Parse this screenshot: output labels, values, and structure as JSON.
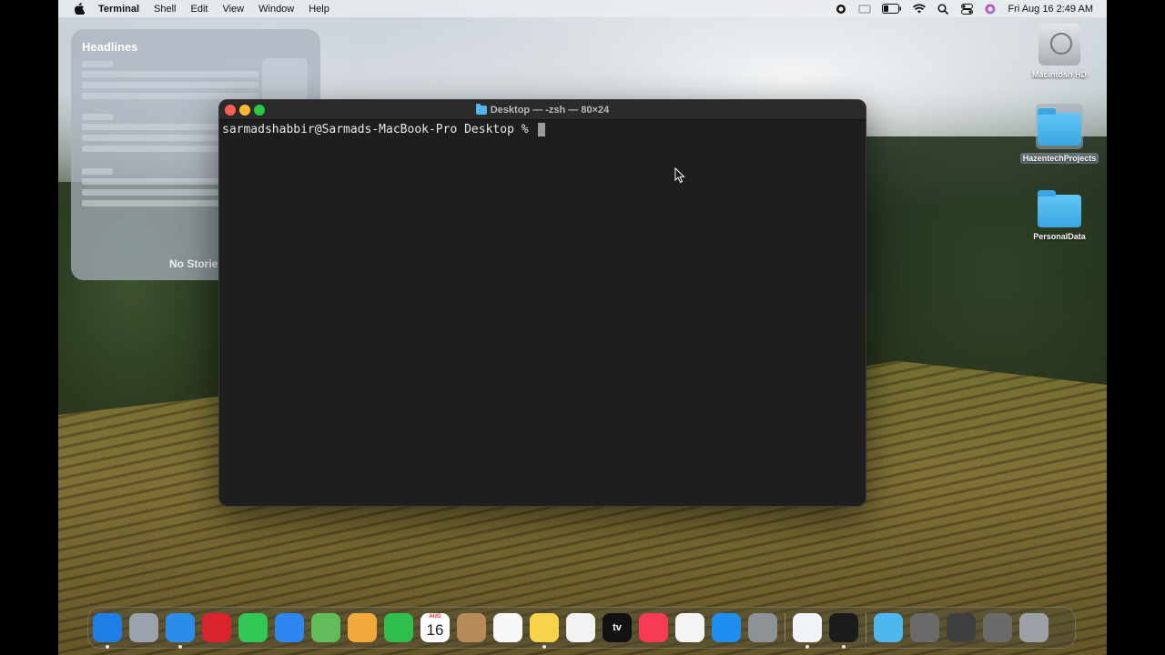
{
  "menubar": {
    "app_name": "Terminal",
    "menus": [
      "Shell",
      "Edit",
      "View",
      "Window",
      "Help"
    ],
    "clock": "Fri Aug 16  2:49 AM",
    "status_icons": [
      "record-icon",
      "keyboard-brightness-icon",
      "battery-icon",
      "wifi-icon",
      "spotlight-icon",
      "control-center-icon",
      "siri-icon"
    ]
  },
  "widget": {
    "title": "Headlines",
    "empty_text": "No Stories"
  },
  "terminal": {
    "title": "Desktop — -zsh — 80×24",
    "prompt": "sarmadshabbir@Sarmads-MacBook-Pro Desktop % "
  },
  "desktop_icons": [
    {
      "label": "Macintosh HD",
      "icon": "hard-drive-icon"
    },
    {
      "label": "HazentechProjects",
      "icon": "folder-icon"
    },
    {
      "label": "PersonalData",
      "icon": "folder-icon"
    }
  ],
  "dock": {
    "apps": [
      {
        "name": "Finder",
        "icon": "finder-icon",
        "color": "#1f7ee6"
      },
      {
        "name": "Launchpad",
        "icon": "launchpad-icon",
        "color": "#9aa2ab"
      },
      {
        "name": "Safari",
        "icon": "safari-icon",
        "color": "#2b8cee"
      },
      {
        "name": "Opera",
        "icon": "opera-icon",
        "color": "#d9232d"
      },
      {
        "name": "Messages",
        "icon": "messages-icon",
        "color": "#31c855"
      },
      {
        "name": "Mail",
        "icon": "mail-icon",
        "color": "#2f86f0"
      },
      {
        "name": "Maps",
        "icon": "maps-icon",
        "color": "#5fbd5a"
      },
      {
        "name": "Photos",
        "icon": "photos-icon",
        "color": "#f2a93b"
      },
      {
        "name": "FaceTime",
        "icon": "facetime-icon",
        "color": "#2fbf4d"
      },
      {
        "name": "Calendar",
        "icon": "calendar-icon",
        "color": "#ffffff",
        "month": "AUG",
        "day": "16"
      },
      {
        "name": "Contacts",
        "icon": "contacts-icon",
        "color": "#b88a5a"
      },
      {
        "name": "Reminders",
        "icon": "reminders-icon",
        "color": "#f7f7f7"
      },
      {
        "name": "Notes",
        "icon": "notes-icon",
        "color": "#f6d34a"
      },
      {
        "name": "Freeform",
        "icon": "freeform-icon",
        "color": "#f2f2f2"
      },
      {
        "name": "TV",
        "icon": "tv-icon",
        "color": "#111111",
        "glyph": "tv"
      },
      {
        "name": "Music",
        "icon": "music-icon",
        "color": "#f73b55"
      },
      {
        "name": "News",
        "icon": "news-icon",
        "color": "#f4f4f4"
      },
      {
        "name": "App Store",
        "icon": "app-store-icon",
        "color": "#1f8cf1"
      },
      {
        "name": "System Settings",
        "icon": "settings-icon",
        "color": "#8d9297"
      }
    ],
    "recent_apps": [
      {
        "name": "Visual Studio Code",
        "icon": "vscode-icon",
        "color": "#f0f4f8"
      },
      {
        "name": "Terminal",
        "icon": "terminal-icon",
        "color": "#1b1b1b"
      }
    ],
    "stacks": [
      {
        "name": "Downloads",
        "icon": "downloads-folder-icon",
        "color": "#4fb6ef"
      },
      {
        "name": "Window 1",
        "icon": "minimized-window-icon",
        "color": "#6a6a6a"
      },
      {
        "name": "Window 2",
        "icon": "minimized-window-icon",
        "color": "#3f3f3f"
      },
      {
        "name": "Window 3",
        "icon": "minimized-window-icon",
        "color": "#6a6a6a"
      },
      {
        "name": "Trash",
        "icon": "trash-icon",
        "color": "#9aa0a6"
      }
    ]
  }
}
